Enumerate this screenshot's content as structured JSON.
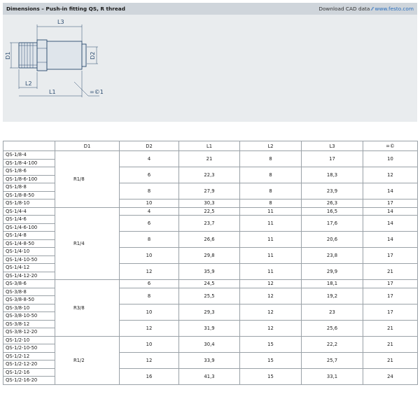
{
  "header": {
    "title": "Dimensions – Push-in fitting QS, R thread",
    "cad_label": "Download CAD data",
    "cad_link": "www.festo.com"
  },
  "drawing": {
    "labels": {
      "l3": "L3",
      "d1": "D1",
      "d2": "D2",
      "l2": "L2",
      "l1": "L1",
      "wrench": "=©1"
    }
  },
  "table": {
    "headers": [
      "",
      "D1",
      "D2",
      "L1",
      "L2",
      "L3",
      "=©"
    ],
    "groups": [
      {
        "d1": "R1/8",
        "sizes": [
          {
            "types": [
              "QS-1/8-4",
              "QS-1/8-4-100"
            ],
            "d2": "4",
            "l1": "21",
            "l2": "8",
            "l3": "17",
            "w": "10"
          },
          {
            "types": [
              "QS-1/8-6",
              "QS-1/8-6-100"
            ],
            "d2": "6",
            "l1": "22,3",
            "l2": "8",
            "l3": "18,3",
            "w": "12"
          },
          {
            "types": [
              "QS-1/8-8",
              "QS-1/8-8-50"
            ],
            "d2": "8",
            "l1": "27,9",
            "l2": "8",
            "l3": "23,9",
            "w": "14"
          },
          {
            "types": [
              "QS-1/8-10"
            ],
            "d2": "10",
            "l1": "30,3",
            "l2": "8",
            "l3": "26,3",
            "w": "17"
          }
        ]
      },
      {
        "d1": "R1/4",
        "sizes": [
          {
            "types": [
              "QS-1/4-4"
            ],
            "d2": "4",
            "l1": "22,5",
            "l2": "11",
            "l3": "16,5",
            "w": "14"
          },
          {
            "types": [
              "QS-1/4-6",
              "QS-1/4-6-100"
            ],
            "d2": "6",
            "l1": "23,7",
            "l2": "11",
            "l3": "17,6",
            "w": "14"
          },
          {
            "types": [
              "QS-1/4-8",
              "QS-1/4-8-50"
            ],
            "d2": "8",
            "l1": "26,6",
            "l2": "11",
            "l3": "20,6",
            "w": "14"
          },
          {
            "types": [
              "QS-1/4-10",
              "QS-1/4-10-50"
            ],
            "d2": "10",
            "l1": "29,8",
            "l2": "11",
            "l3": "23,8",
            "w": "17"
          },
          {
            "types": [
              "QS-1/4-12",
              "QS-1/4-12-20"
            ],
            "d2": "12",
            "l1": "35,9",
            "l2": "11",
            "l3": "29,9",
            "w": "21"
          }
        ]
      },
      {
        "d1": "R3/8",
        "sizes": [
          {
            "types": [
              "QS-3/8-6"
            ],
            "d2": "6",
            "l1": "24,5",
            "l2": "12",
            "l3": "18,1",
            "w": "17"
          },
          {
            "types": [
              "QS-3/8-8",
              "QS-3/8-8-50"
            ],
            "d2": "8",
            "l1": "25,5",
            "l2": "12",
            "l3": "19,2",
            "w": "17"
          },
          {
            "types": [
              "QS-3/8-10",
              "QS-3/8-10-50"
            ],
            "d2": "10",
            "l1": "29,3",
            "l2": "12",
            "l3": "23",
            "w": "17"
          },
          {
            "types": [
              "QS-3/8-12",
              "QS-3/8-12-20"
            ],
            "d2": "12",
            "l1": "31,9",
            "l2": "12",
            "l3": "25,6",
            "w": "21"
          }
        ]
      },
      {
        "d1": "R1/2",
        "sizes": [
          {
            "types": [
              "QS-1/2-10",
              "QS-1/2-10-50"
            ],
            "d2": "10",
            "l1": "30,4",
            "l2": "15",
            "l3": "22,2",
            "w": "21"
          },
          {
            "types": [
              "QS-1/2-12",
              "QS-1/2-12-20"
            ],
            "d2": "12",
            "l1": "33,9",
            "l2": "15",
            "l3": "25,7",
            "w": "21"
          },
          {
            "types": [
              "QS-1/2-16",
              "QS-1/2-16-20"
            ],
            "d2": "16",
            "l1": "41,3",
            "l2": "15",
            "l3": "33,1",
            "w": "24"
          }
        ]
      }
    ]
  }
}
